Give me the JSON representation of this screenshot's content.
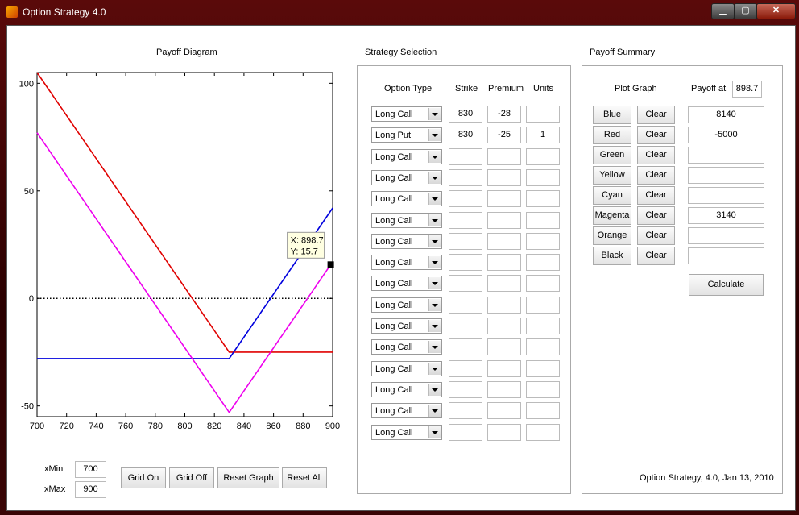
{
  "window": {
    "title": "Option Strategy 4.0",
    "controls": {
      "minimize": "▁",
      "maximize": "▢",
      "close": "✕"
    }
  },
  "payoff_diagram": {
    "title": "Payoff Diagram",
    "datatip": {
      "x_label": "X: 898.7",
      "y_label": "Y: 15.7"
    }
  },
  "chart_data": {
    "type": "line",
    "title": "Payoff Diagram",
    "xlim": [
      700,
      900
    ],
    "ylim": [
      -55,
      105
    ],
    "x_ticks": [
      700,
      720,
      740,
      760,
      780,
      800,
      820,
      840,
      860,
      880,
      900
    ],
    "y_ticks": [
      -50,
      0,
      50,
      100
    ],
    "zero_line": {
      "y": 0,
      "style": "dotted",
      "color": "#000000"
    },
    "series": [
      {
        "color": "#e00000",
        "points": [
          [
            700,
            105
          ],
          [
            830,
            -25
          ],
          [
            900,
            -25
          ]
        ]
      },
      {
        "color": "#0000dd",
        "points": [
          [
            700,
            -28
          ],
          [
            830,
            -28
          ],
          [
            900,
            42
          ]
        ]
      },
      {
        "color": "#ee00ee",
        "points": [
          [
            700,
            77
          ],
          [
            830,
            -53
          ],
          [
            898.7,
            15.7
          ]
        ]
      }
    ],
    "datatip_point": {
      "x": 898.7,
      "y": 15.7
    }
  },
  "range_controls": {
    "xmin_label": "xMin",
    "xmin_value": "700",
    "xmax_label": "xMax",
    "xmax_value": "900"
  },
  "buttons": {
    "grid_on": "Grid On",
    "grid_off": "Grid Off",
    "reset_graph": "Reset Graph",
    "reset_all": "Reset All",
    "calculate": "Calculate"
  },
  "strategy_selection": {
    "title": "Strategy Selection",
    "headers": {
      "option_type": "Option Type",
      "strike": "Strike",
      "premium": "Premium",
      "units": "Units"
    },
    "rows": [
      {
        "type": "Long Call",
        "strike": "830",
        "premium": "-28",
        "units": ""
      },
      {
        "type": "Long Put",
        "strike": "830",
        "premium": "-25",
        "units": "1"
      },
      {
        "type": "Long Call",
        "strike": "",
        "premium": "",
        "units": ""
      },
      {
        "type": "Long Call",
        "strike": "",
        "premium": "",
        "units": ""
      },
      {
        "type": "Long Call",
        "strike": "",
        "premium": "",
        "units": ""
      },
      {
        "type": "Long Call",
        "strike": "",
        "premium": "",
        "units": ""
      },
      {
        "type": "Long Call",
        "strike": "",
        "premium": "",
        "units": ""
      },
      {
        "type": "Long Call",
        "strike": "",
        "premium": "",
        "units": ""
      },
      {
        "type": "Long Call",
        "strike": "",
        "premium": "",
        "units": ""
      },
      {
        "type": "Long Call",
        "strike": "",
        "premium": "",
        "units": ""
      },
      {
        "type": "Long Call",
        "strike": "",
        "premium": "",
        "units": ""
      },
      {
        "type": "Long Call",
        "strike": "",
        "premium": "",
        "units": ""
      },
      {
        "type": "Long Call",
        "strike": "",
        "premium": "",
        "units": ""
      },
      {
        "type": "Long Call",
        "strike": "",
        "premium": "",
        "units": ""
      },
      {
        "type": "Long Call",
        "strike": "",
        "premium": "",
        "units": ""
      },
      {
        "type": "Long Call",
        "strike": "",
        "premium": "",
        "units": ""
      }
    ]
  },
  "payoff_summary": {
    "title": "Payoff Summary",
    "plot_graph_label": "Plot Graph",
    "payoff_at_label": "Payoff at",
    "payoff_at_value": "898.7",
    "clear_label": "Clear",
    "rows": [
      {
        "color_name": "Blue",
        "value": "8140"
      },
      {
        "color_name": "Red",
        "value": "-5000"
      },
      {
        "color_name": "Green",
        "value": ""
      },
      {
        "color_name": "Yellow",
        "value": ""
      },
      {
        "color_name": "Cyan",
        "value": ""
      },
      {
        "color_name": "Magenta",
        "value": "3140"
      },
      {
        "color_name": "Orange",
        "value": ""
      },
      {
        "color_name": "Black",
        "value": ""
      }
    ],
    "footer": "Option Strategy, 4.0, Jan 13, 2010"
  }
}
